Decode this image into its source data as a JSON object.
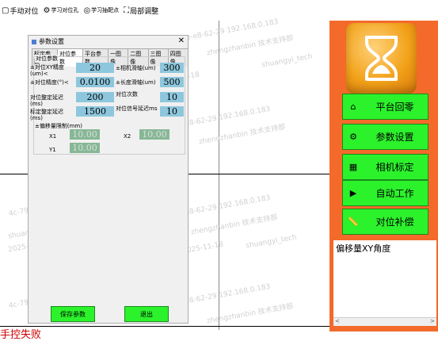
{
  "toolbar": {
    "items": [
      {
        "label": "手动对位",
        "icon": "square-icon"
      },
      {
        "label": "学习对位孔",
        "icon": "gear-icon"
      },
      {
        "label": "学习抽靶点",
        "icon": "target-icon"
      },
      {
        "label": "局部调整",
        "icon": "frame-icon"
      }
    ]
  },
  "footer": {
    "text": "手控失败"
  },
  "watermark": {
    "text1": "4c-79-6e-e8-62-29 192.168.0.183",
    "text2": "zhengzhanbin 技术支持部",
    "text3": "shuangyi_tech",
    "text4": "2025-11-18"
  },
  "right_panel": {
    "buttons": [
      {
        "label": "平台回零",
        "icon": "home-icon"
      },
      {
        "label": "参数设置",
        "icon": "gear-icon"
      },
      {
        "label": "相机标定",
        "icon": "calibrate-icon"
      },
      {
        "label": "自动工作",
        "icon": "play-icon"
      },
      {
        "label": "对位补偿",
        "icon": "ruler-icon"
      }
    ],
    "info_title": "偏移量XY角度",
    "scroll_left": "<",
    "scroll_right": ">"
  },
  "dialog": {
    "title": "参数设置",
    "close": "✕",
    "tabs": [
      "标定参数",
      "对位参数",
      "平台参数",
      "一图像",
      "二图像",
      "三图像",
      "四图像"
    ],
    "active_tab": "对位参数",
    "group_title": "对位参数",
    "fields": {
      "xy_precision_label": "±对位XY精度(um)<",
      "xy_precision": "20",
      "camera_slide_label": "±相机滑轴(um)",
      "camera_slide": "300",
      "angle_precision_label": "±对位精度(°)<",
      "angle_precision": "0.0100",
      "length_slide_label": "±长度滑轴(um)",
      "length_slide": "500",
      "stable_delay_label": "对位整定延迟(ms)",
      "stable_delay": "200",
      "align_count_label": "对位次数",
      "align_count": "10",
      "calib_delay_label": "标定整定延迟(ms)",
      "calib_delay": "1500",
      "signal_delay_label": "对位信号延迟ms",
      "signal_delay": "10"
    },
    "offset_group_title": "±偏移量限制(mm)",
    "x1_label": "X1",
    "x1_value": "10.00",
    "x2_label": "X2",
    "x2_value": "10.00",
    "y1_label": "Y1",
    "y1_value": "10.00",
    "save_button": "保存参数",
    "exit_button": "退出"
  }
}
